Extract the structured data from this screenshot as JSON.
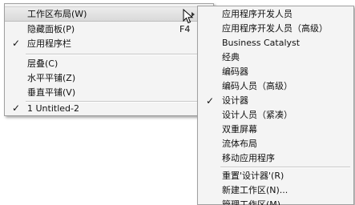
{
  "main_menu": {
    "items": [
      {
        "label": "工作区布局(W)"
      },
      {
        "label": "隐藏面板(P)",
        "shortcut": "F4"
      },
      {
        "label": "应用程序栏",
        "checked": "✓"
      },
      {
        "label": "层叠(C)"
      },
      {
        "label": "水平平铺(Z)"
      },
      {
        "label": "垂直平铺(V)"
      },
      {
        "label": "1 Untitled-2",
        "checked": "✓"
      }
    ]
  },
  "submenu": {
    "items": [
      {
        "label": "应用程序开发人员"
      },
      {
        "label": "应用程序开发人员（高级）"
      },
      {
        "label": "Business Catalyst"
      },
      {
        "label": "经典"
      },
      {
        "label": "编码器"
      },
      {
        "label": "编码人员（高级）"
      },
      {
        "label": "设计器",
        "checked": "✓"
      },
      {
        "label": "设计人员（紧凑）"
      },
      {
        "label": "双重屏幕"
      },
      {
        "label": "流体布局"
      },
      {
        "label": "移动应用程序"
      },
      {
        "label": "重置'设计器'(R)"
      },
      {
        "label": "新建工作区(N)..."
      },
      {
        "label": "管理工作区(M)..."
      }
    ]
  }
}
